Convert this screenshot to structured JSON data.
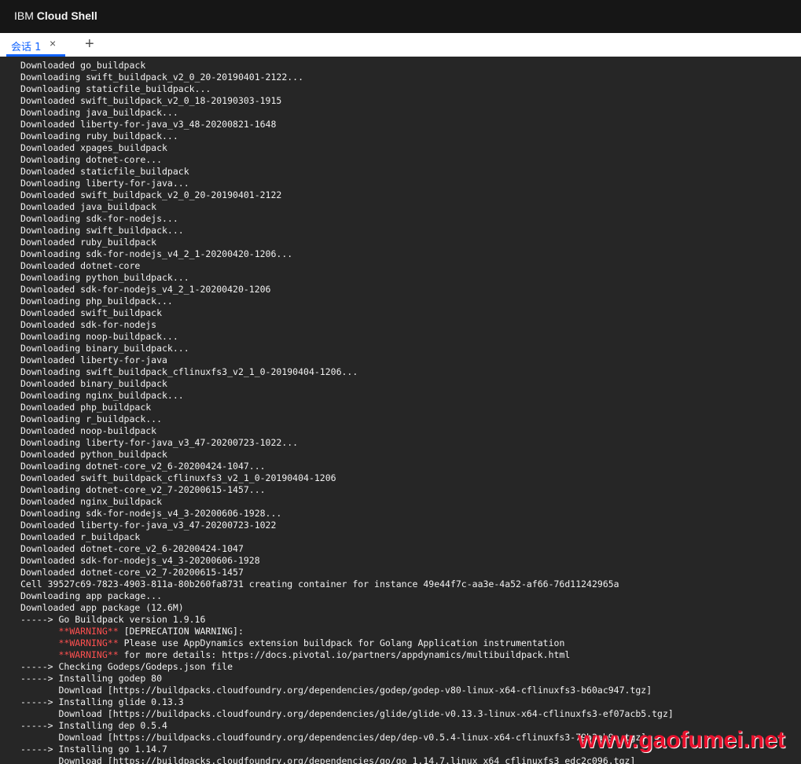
{
  "header": {
    "brand_prefix": "IBM",
    "brand_name": "Cloud Shell"
  },
  "tabs": [
    {
      "label": "会话 1",
      "close": "×"
    }
  ],
  "new_tab": "+",
  "terminal": {
    "lines": [
      {
        "text": "Downloaded go_buildpack"
      },
      {
        "text": "Downloading swift_buildpack_v2_0_20-20190401-2122..."
      },
      {
        "text": "Downloading staticfile_buildpack..."
      },
      {
        "text": "Downloaded swift_buildpack_v2_0_18-20190303-1915"
      },
      {
        "text": "Downloading java_buildpack..."
      },
      {
        "text": "Downloaded liberty-for-java_v3_48-20200821-1648"
      },
      {
        "text": "Downloading ruby_buildpack..."
      },
      {
        "text": "Downloaded xpages_buildpack"
      },
      {
        "text": "Downloading dotnet-core..."
      },
      {
        "text": "Downloaded staticfile_buildpack"
      },
      {
        "text": "Downloading liberty-for-java..."
      },
      {
        "text": "Downloaded swift_buildpack_v2_0_20-20190401-2122"
      },
      {
        "text": "Downloaded java_buildpack"
      },
      {
        "text": "Downloading sdk-for-nodejs..."
      },
      {
        "text": "Downloading swift_buildpack..."
      },
      {
        "text": "Downloaded ruby_buildpack"
      },
      {
        "text": "Downloading sdk-for-nodejs_v4_2_1-20200420-1206..."
      },
      {
        "text": "Downloaded dotnet-core"
      },
      {
        "text": "Downloading python_buildpack..."
      },
      {
        "text": "Downloaded sdk-for-nodejs_v4_2_1-20200420-1206"
      },
      {
        "text": "Downloading php_buildpack..."
      },
      {
        "text": "Downloaded swift_buildpack"
      },
      {
        "text": "Downloaded sdk-for-nodejs"
      },
      {
        "text": "Downloading noop-buildpack..."
      },
      {
        "text": "Downloading binary_buildpack..."
      },
      {
        "text": "Downloaded liberty-for-java"
      },
      {
        "text": "Downloading swift_buildpack_cflinuxfs3_v2_1_0-20190404-1206..."
      },
      {
        "text": "Downloaded binary_buildpack"
      },
      {
        "text": "Downloading nginx_buildpack..."
      },
      {
        "text": "Downloaded php_buildpack"
      },
      {
        "text": "Downloading r_buildpack..."
      },
      {
        "text": "Downloaded noop-buildpack"
      },
      {
        "text": "Downloading liberty-for-java_v3_47-20200723-1022..."
      },
      {
        "text": "Downloaded python_buildpack"
      },
      {
        "text": "Downloading dotnet-core_v2_6-20200424-1047..."
      },
      {
        "text": "Downloaded swift_buildpack_cflinuxfs3_v2_1_0-20190404-1206"
      },
      {
        "text": "Downloading dotnet-core_v2_7-20200615-1457..."
      },
      {
        "text": "Downloaded nginx_buildpack"
      },
      {
        "text": "Downloading sdk-for-nodejs_v4_3-20200606-1928..."
      },
      {
        "text": "Downloaded liberty-for-java_v3_47-20200723-1022"
      },
      {
        "text": "Downloaded r_buildpack"
      },
      {
        "text": "Downloaded dotnet-core_v2_6-20200424-1047"
      },
      {
        "text": "Downloaded sdk-for-nodejs_v4_3-20200606-1928"
      },
      {
        "text": "Downloaded dotnet-core_v2_7-20200615-1457"
      },
      {
        "text": "Cell 39527c69-7823-4903-811a-80b260fa8731 creating container for instance 49e44f7c-aa3e-4a52-af66-76d11242965a"
      },
      {
        "text": "Downloading app package..."
      },
      {
        "text": "Downloaded app package (12.6M)"
      },
      {
        "text": "-----> Go Buildpack version 1.9.16"
      },
      {
        "prefix": "       ",
        "warn": "**WARNING**",
        "text": " [DEPRECATION WARNING]:"
      },
      {
        "prefix": "       ",
        "warn": "**WARNING**",
        "text": " Please use AppDynamics extension buildpack for Golang Application instrumentation"
      },
      {
        "prefix": "       ",
        "warn": "**WARNING**",
        "text": " for more details: https://docs.pivotal.io/partners/appdynamics/multibuildpack.html"
      },
      {
        "text": "-----> Checking Godeps/Godeps.json file"
      },
      {
        "text": "-----> Installing godep 80"
      },
      {
        "text": "       Download [https://buildpacks.cloudfoundry.org/dependencies/godep/godep-v80-linux-x64-cflinuxfs3-b60ac947.tgz]"
      },
      {
        "text": "-----> Installing glide 0.13.3"
      },
      {
        "text": "       Download [https://buildpacks.cloudfoundry.org/dependencies/glide/glide-v0.13.3-linux-x64-cflinuxfs3-ef07acb5.tgz]"
      },
      {
        "text": "-----> Installing dep 0.5.4"
      },
      {
        "text": "       Download [https://buildpacks.cloudfoundry.org/dependencies/dep/dep-v0.5.4-linux-x64-cflinuxfs3-79b3ab9a.tgz]"
      },
      {
        "text": "-----> Installing go 1.14.7"
      },
      {
        "text": "       Download [https://buildpacks.cloudfoundry.org/dependencies/go/go_1.14.7.linux_x64_cflinuxfs3_edc2c096.tgz]"
      }
    ]
  },
  "watermark": "www.gaofumei.net",
  "colors": {
    "accent": "#0f62fe",
    "warning": "#ff5050",
    "background": "#262626",
    "header": "#161616"
  }
}
